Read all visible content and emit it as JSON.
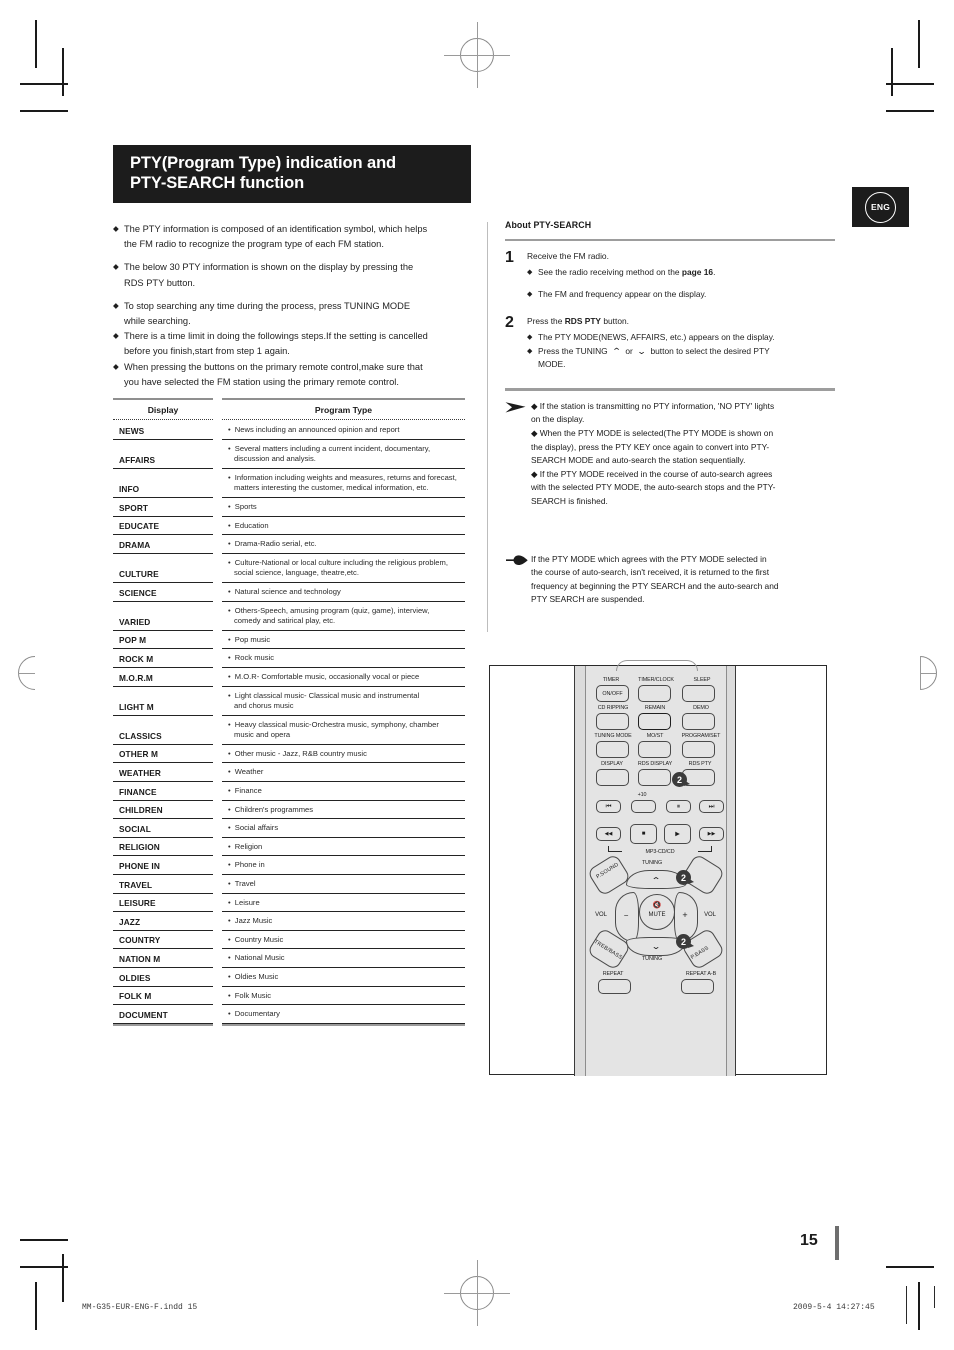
{
  "page": {
    "title_line1": "PTY(Program Type) indication and",
    "title_line2": "PTY-SEARCH function",
    "language_badge": "ENG",
    "page_number": "15",
    "footer_left": "MM-G35-EUR-ENG-F.indd   15",
    "footer_right": "2009-5-4   14:27:45"
  },
  "intro": {
    "groups": [
      [
        "The PTY information is composed of an identification symbol, which helps",
        "the FM radio to recognize the program type of each FM station."
      ],
      [
        "The below 30 PTY information is shown on the display by pressing the",
        "RDS PTY button."
      ],
      [
        "To stop searching any time during the process, press TUNING MODE",
        "while searching."
      ],
      [
        "There is a time limit in doing the followings steps.If the setting is cancelled",
        "before you finish,start from step 1 again."
      ],
      [
        "When pressing the buttons on the primary remote control,make sure that",
        "you have selected the FM station using the primary remote control."
      ]
    ],
    "bullet_glyph": "◆"
  },
  "table": {
    "header_display": "Display",
    "header_program": "Program Type",
    "bullet": "•",
    "rows": [
      {
        "display": "NEWS",
        "program": [
          "News including an announced opinion and report"
        ]
      },
      {
        "display": "AFFAIRS",
        "program": [
          "Several matters including a current incident, documentary,",
          "discussion and analysis."
        ]
      },
      {
        "display": "INFO",
        "program": [
          "Information including weights and measures, returns and forecast,",
          "matters interesting the customer, medical information, etc."
        ]
      },
      {
        "display": "SPORT",
        "program": [
          "Sports"
        ]
      },
      {
        "display": "EDUCATE",
        "program": [
          "Education"
        ]
      },
      {
        "display": "DRAMA",
        "program": [
          "Drama-Radio serial, etc."
        ]
      },
      {
        "display": "CULTURE",
        "program": [
          "Culture-National or local culture including the religious problem,",
          "social science, language, theatre,etc."
        ]
      },
      {
        "display": "SCIENCE",
        "program": [
          "Natural science and technology"
        ]
      },
      {
        "display": "VARIED",
        "program": [
          "Others-Speech, amusing program (quiz, game), interview,",
          "comedy and satirical play, etc."
        ]
      },
      {
        "display": "POP M",
        "program": [
          "Pop music"
        ]
      },
      {
        "display": "ROCK M",
        "program": [
          "Rock music"
        ]
      },
      {
        "display": "M.O.R.M",
        "program": [
          "M.O.R- Comfortable music, occasionally vocal or piece"
        ]
      },
      {
        "display": "LIGHT M",
        "program": [
          "Light classical music- Classical music and instrumental",
          "and chorus music"
        ]
      },
      {
        "display": "CLASSICS",
        "program": [
          "Heavy classical  music-Orchestra music, symphony, chamber",
          "music and opera"
        ]
      },
      {
        "display": "OTHER M",
        "program": [
          "Other music - Jazz, R&B country music"
        ]
      },
      {
        "display": "WEATHER",
        "program": [
          "Weather"
        ]
      },
      {
        "display": "FINANCE",
        "program": [
          "Finance"
        ]
      },
      {
        "display": "CHILDREN",
        "program": [
          "Children's programmes"
        ]
      },
      {
        "display": "SOCIAL",
        "program": [
          "Social affairs"
        ]
      },
      {
        "display": "RELIGION",
        "program": [
          "Religion"
        ]
      },
      {
        "display": "PHONE IN",
        "program": [
          "Phone in"
        ]
      },
      {
        "display": "TRAVEL",
        "program": [
          "Travel"
        ]
      },
      {
        "display": "LEISURE",
        "program": [
          "Leisure"
        ]
      },
      {
        "display": "JAZZ",
        "program": [
          "Jazz Music"
        ]
      },
      {
        "display": "COUNTRY",
        "program": [
          "Country Music"
        ]
      },
      {
        "display": "NATION M",
        "program": [
          "National Music"
        ]
      },
      {
        "display": "OLDIES",
        "program": [
          "Oldies Music"
        ]
      },
      {
        "display": "FOLK M",
        "program": [
          "Folk Music"
        ]
      },
      {
        "display": "DOCUMENT",
        "program": [
          "Documentary"
        ]
      }
    ]
  },
  "about": {
    "heading": "About PTY-SEARCH",
    "steps": [
      {
        "num": "1",
        "lead": "Receive the FM radio.",
        "subs": [
          "See the radio receiving method on the page 16.",
          "The FM and frequency appear on the display."
        ]
      },
      {
        "num": "2",
        "lead": "Press the RDS PTY button.",
        "subs": [
          "The PTY MODE(NEWS, AFFAIRS, etc.) appears on the display.",
          "Press the TUNING ⌃  or ⌄  button to select the desired PTY MODE."
        ]
      }
    ],
    "step1_lead": "Receive the FM radio.",
    "step1_sub1_a": "See the radio receiving method on the ",
    "step1_sub1_b": "page 16",
    "step1_sub1_c": ".",
    "step1_sub2": "The FM and frequency appear on the display.",
    "step2_lead_a": "Press the ",
    "step2_lead_b": "RDS PTY",
    "step2_lead_c": " button.",
    "step2_sub1": "The PTY MODE(NEWS, AFFAIRS, etc.) appears on the display.",
    "step2_sub2_a": "Press the TUNING",
    "step2_sub2_b": "or",
    "step2_sub2_c": "button to select the desired PTY",
    "step2_sub2_d": "MODE."
  },
  "notes": {
    "arrow_note_lines": [
      "◆  If the station is transmitting no PTY information, 'NO PTY' lights",
      "on the display.",
      "◆  When the PTY MODE is selected(The PTY MODE is shown on",
      "the display), press the PTY KEY once again to convert into PTY-",
      "SEARCH MODE and auto-search the station sequentially.",
      "◆  If the PTY MODE received in the course of auto-search agrees",
      "with the selected PTY MODE, the auto-search stops and the PTY-",
      "SEARCH is finished."
    ],
    "hand_note_lines": [
      "If the PTY MODE which agrees with the PTY MODE selected in",
      "the course of auto-search, isn't received, it is returned to the first",
      "frequency at beginning the PTY SEARCH and the auto-search and",
      "PTY SEARCH are suspended."
    ]
  },
  "remote": {
    "buttons": {
      "timer_label": "TIMER",
      "timer_text": "ON/OFF",
      "timerclock_label": "TIMER/CLOCK",
      "sleep_label": "SLEEP",
      "cdripping_label": "CD RIPPING",
      "remain_label": "REMAIN",
      "demo_label": "DEMO",
      "tuningmode_label": "TUNING MODE",
      "most_label": "MO/ST",
      "programset_label": "PROGRAM/SET",
      "display_label": "DISPLAY",
      "rdsdisplay_label": "RDS DISPLAY",
      "rdspty_label": "RDS PTY",
      "plus10_label": "+10",
      "prev_glyph": "⏮",
      "pause_glyph": "⏸",
      "next_glyph": "⏭",
      "rew_glyph": "◀◀",
      "stop_glyph": "■",
      "play_glyph": "▶",
      "ff_glyph": "▶▶",
      "mp3cdcd_label": "MP3-CD/CD",
      "psound_label": "P.SOUND",
      "tuning_up_label": "TUNING",
      "tuning_down_label": "TUNING",
      "tuning_up_glyph": "⌃",
      "tuning_down_glyph": "⌄",
      "vol_left_label": "VOL",
      "vol_right_label": "VOL",
      "minus_glyph": "−",
      "plus_glyph": "+",
      "mute_label": "MUTE",
      "mute_glyph": "🔇",
      "trebbass_label": "TREB/BASS",
      "pbass_label": "P.BASS",
      "repeat_label": "REPEAT",
      "repeatab_label": "REPEAT A-B"
    },
    "callout_badge": "2"
  }
}
